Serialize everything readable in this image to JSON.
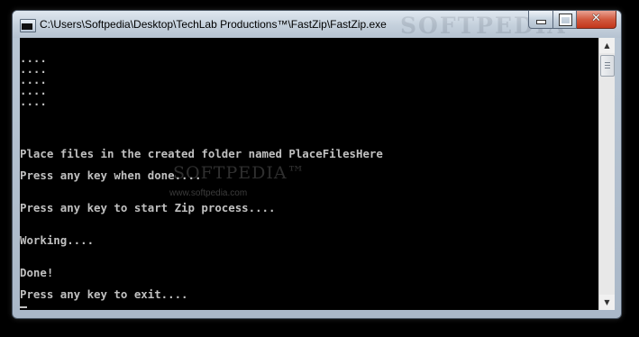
{
  "window": {
    "title": "C:\\Users\\Softpedia\\Desktop\\TechLab Productions™\\FastZip\\FastZip.exe",
    "title_watermark": "SOFTPEDIA",
    "minimize_label": "",
    "maximize_label": "",
    "close_label": "✕"
  },
  "console": {
    "lines": [
      "....",
      "....",
      "....",
      "....",
      "....",
      "Place files in the created folder named PlaceFilesHere",
      "Press any key when done....",
      "Press any key to start Zip process....",
      "Working....",
      "Done!",
      "Press any key to exit...."
    ]
  },
  "watermark": {
    "logo": "SOFTPEDIA™",
    "url": "www.softpedia.com"
  },
  "scrollbar": {
    "up_arrow": "▲",
    "down_arrow": "▼"
  },
  "colors": {
    "console_background": "#000000",
    "console_text": "#c0c0c0",
    "close_button": "#c94a2f"
  }
}
